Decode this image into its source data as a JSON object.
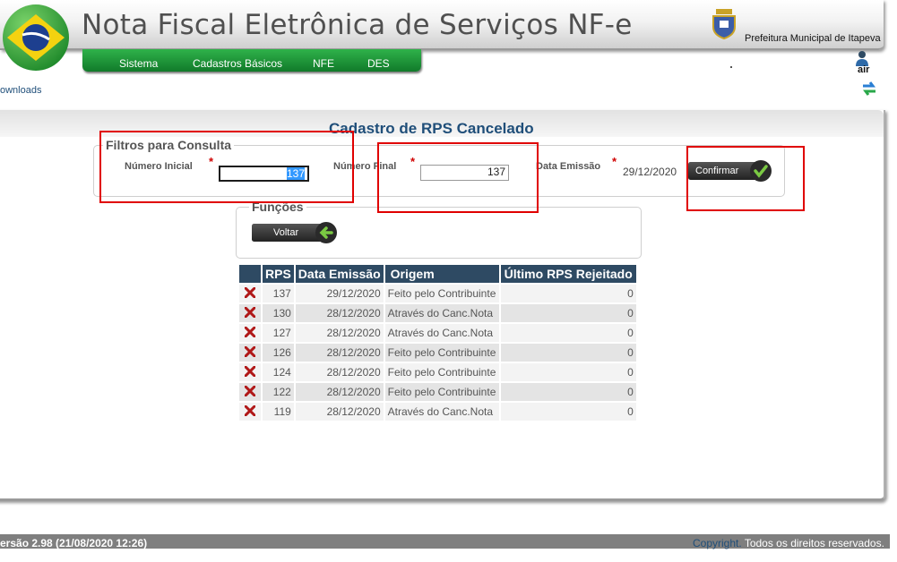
{
  "header": {
    "title": "Nota Fiscal Eletrônica de Serviços NF-e",
    "prefeitura": "Prefeitura Municipal de Itapeva",
    "user": "air",
    "downloads": "ownloads"
  },
  "menu": [
    "Sistema",
    "Cadastros Básicos",
    "NFE",
    "DES"
  ],
  "page": {
    "title": "Cadastro de RPS Cancelado"
  },
  "filters": {
    "legend": "Filtros para Consulta",
    "numero_inicial_label": "Número Inicial",
    "numero_inicial_value": "137",
    "numero_final_label": "Número Final",
    "numero_final_value": "137",
    "data_emissao_label": "Data Emissão",
    "data_emissao_value": "29/12/2020",
    "required_mark": "*",
    "confirm_label": "Confirmar"
  },
  "functions": {
    "legend": "Funções",
    "back_label": "Voltar"
  },
  "table": {
    "columns": [
      "",
      "RPS",
      "Data Emissão",
      "Origem",
      "Último RPS Rejeitado"
    ],
    "rows": [
      {
        "rps": "137",
        "data": "29/12/2020",
        "origem": "Feito pelo Contribuinte",
        "ultimo": "0"
      },
      {
        "rps": "130",
        "data": "28/12/2020",
        "origem": "Através do Canc.Nota",
        "ultimo": "0"
      },
      {
        "rps": "127",
        "data": "28/12/2020",
        "origem": "Através do Canc.Nota",
        "ultimo": "0"
      },
      {
        "rps": "126",
        "data": "28/12/2020",
        "origem": "Feito pelo Contribuinte",
        "ultimo": "0"
      },
      {
        "rps": "124",
        "data": "28/12/2020",
        "origem": "Feito pelo Contribuinte",
        "ultimo": "0"
      },
      {
        "rps": "122",
        "data": "28/12/2020",
        "origem": "Feito pelo Contribuinte",
        "ultimo": "0"
      },
      {
        "rps": "119",
        "data": "28/12/2020",
        "origem": "Através do Canc.Nota",
        "ultimo": "0"
      }
    ]
  },
  "footer": {
    "version": "ersão 2.98 (21/08/2020 12:26)",
    "copyright": "Copyright.",
    "rights": "Todos os direitos reservados."
  },
  "colors": {
    "header_blue": "#1f4e79",
    "menu_green": "#1e9a3a",
    "table_head": "#2e4a63",
    "highlight_red": "#e00000"
  },
  "icons": [
    "brazil-flag-logo",
    "municipal-crest-icon",
    "user-icon",
    "refresh-icon",
    "delete-x-icon",
    "check-icon",
    "back-arrow-icon"
  ]
}
